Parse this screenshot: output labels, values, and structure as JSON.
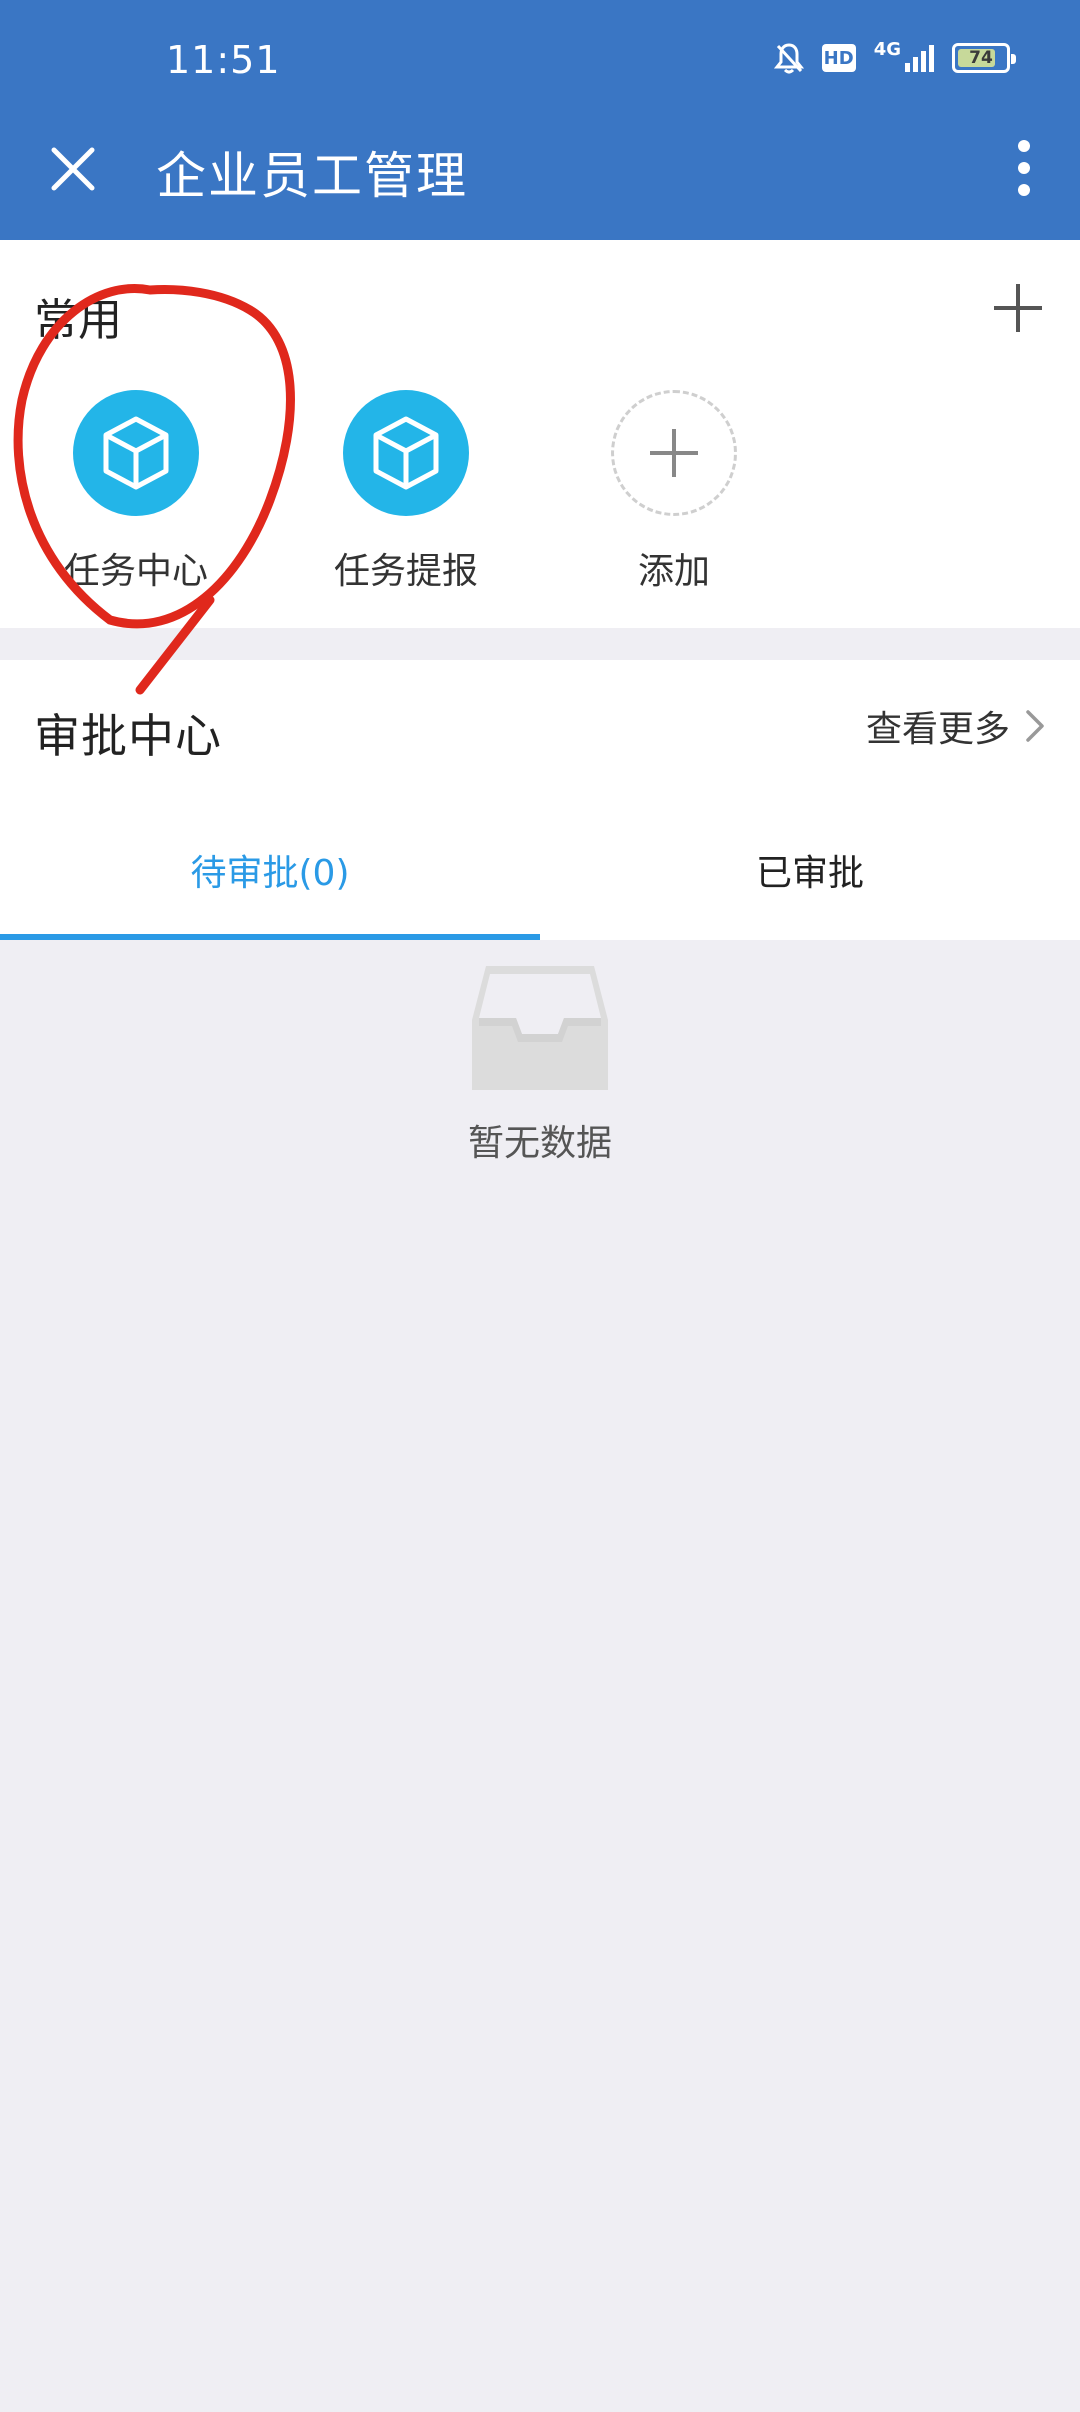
{
  "status_bar": {
    "time": "11:51",
    "network": "HD",
    "signal_label": "4G",
    "battery_level": "74"
  },
  "header": {
    "title": "企业员工管理"
  },
  "common": {
    "title": "常用",
    "apps": [
      {
        "label": "任务中心"
      },
      {
        "label": "任务提报"
      },
      {
        "label": "添加"
      }
    ]
  },
  "approval": {
    "title": "审批中心",
    "view_more": "查看更多",
    "tabs": [
      {
        "label": "待审批(0)",
        "active": true
      },
      {
        "label": "已审批",
        "active": false
      }
    ]
  },
  "empty_state": {
    "label": "暂无数据"
  },
  "colors": {
    "header_blue": "#3a76c4",
    "accent_blue": "#2a9ae6",
    "icon_cyan": "#23b5e8",
    "annotation_red": "#e0281c"
  }
}
